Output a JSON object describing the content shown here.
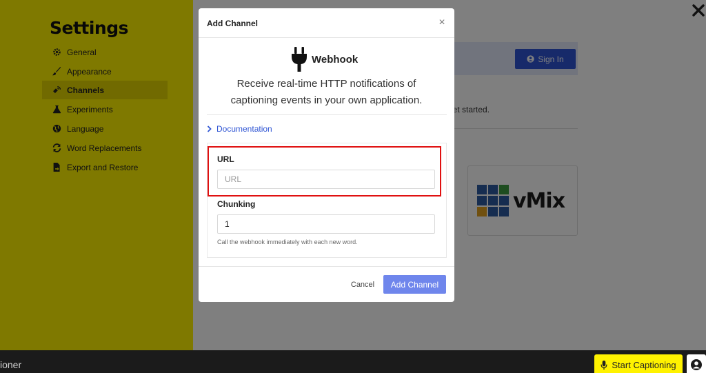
{
  "sidebar": {
    "title": "Settings",
    "items": [
      {
        "label": "General",
        "icon": "gear-icon"
      },
      {
        "label": "Appearance",
        "icon": "brush-icon"
      },
      {
        "label": "Channels",
        "icon": "satellite-icon",
        "active": true
      },
      {
        "label": "Experiments",
        "icon": "flask-icon"
      },
      {
        "label": "Language",
        "icon": "globe-icon"
      },
      {
        "label": "Word Replacements",
        "icon": "sync-icon"
      },
      {
        "label": "Export and Restore",
        "icon": "file-export-icon"
      }
    ]
  },
  "main": {
    "sign_in_label": "Sign In",
    "get_started_fragment": "get started.",
    "vmix_label": "vMix"
  },
  "bottom_bar": {
    "app_name_fragment": "ioner",
    "start_captioning_label": "Start Captioning"
  },
  "modal": {
    "title": "Add Channel",
    "close_glyph": "×",
    "integration_name": "Webhook",
    "description": "Receive real-time HTTP notifications of captioning events in your own application.",
    "documentation_link": "Documentation",
    "url_field": {
      "label": "URL",
      "placeholder": "URL",
      "value": ""
    },
    "chunking_field": {
      "label": "Chunking",
      "value": "1",
      "help": "Call the webhook immediately with each new word."
    },
    "cancel_label": "Cancel",
    "submit_label": "Add Channel"
  },
  "colors": {
    "sidebar_yellow": "#fff200",
    "primary_blue": "#2f55d4",
    "submit_disabled": "#6f86ec",
    "highlight_red": "#e01010"
  }
}
